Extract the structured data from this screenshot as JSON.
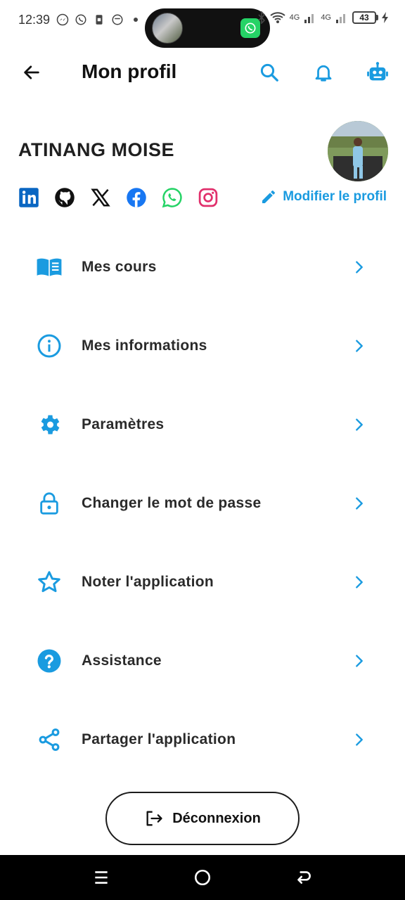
{
  "status_bar": {
    "time": "12:39",
    "network_1": "4G",
    "network_2": "4G",
    "battery": "43",
    "left_icons": [
      "messenger-icon",
      "whatsapp-icon",
      "sim-icon",
      "chat-icon",
      "dot-icon"
    ],
    "right_icons": [
      "bluetooth-icon",
      "wifi-icon",
      "signal-icon",
      "signal-icon",
      "battery-icon",
      "charging-icon"
    ]
  },
  "app_bar": {
    "title": "Mon profil",
    "actions": [
      "search-icon",
      "bell-icon",
      "robot-icon"
    ]
  },
  "profile": {
    "name": "ATINANG MOISE",
    "edit_label": "Modifier le profil",
    "social": [
      "linkedin-icon",
      "github-icon",
      "x-icon",
      "facebook-icon",
      "whatsapp-icon",
      "instagram-icon"
    ]
  },
  "menu": {
    "items": [
      {
        "label": "Mes cours",
        "icon": "book-icon"
      },
      {
        "label": "Mes informations",
        "icon": "info-icon"
      },
      {
        "label": "Paramètres",
        "icon": "gear-icon"
      },
      {
        "label": "Changer le mot de passe",
        "icon": "lock-icon"
      },
      {
        "label": "Noter l'application",
        "icon": "star-icon"
      },
      {
        "label": "Assistance",
        "icon": "help-icon"
      },
      {
        "label": "Partager l'application",
        "icon": "share-icon"
      }
    ]
  },
  "logout": {
    "label": "Déconnexion",
    "icon": "logout-icon"
  },
  "colors": {
    "accent": "#1a9be0",
    "text": "#1c1c1c",
    "background": "#ffffff",
    "navbar": "#000000"
  }
}
